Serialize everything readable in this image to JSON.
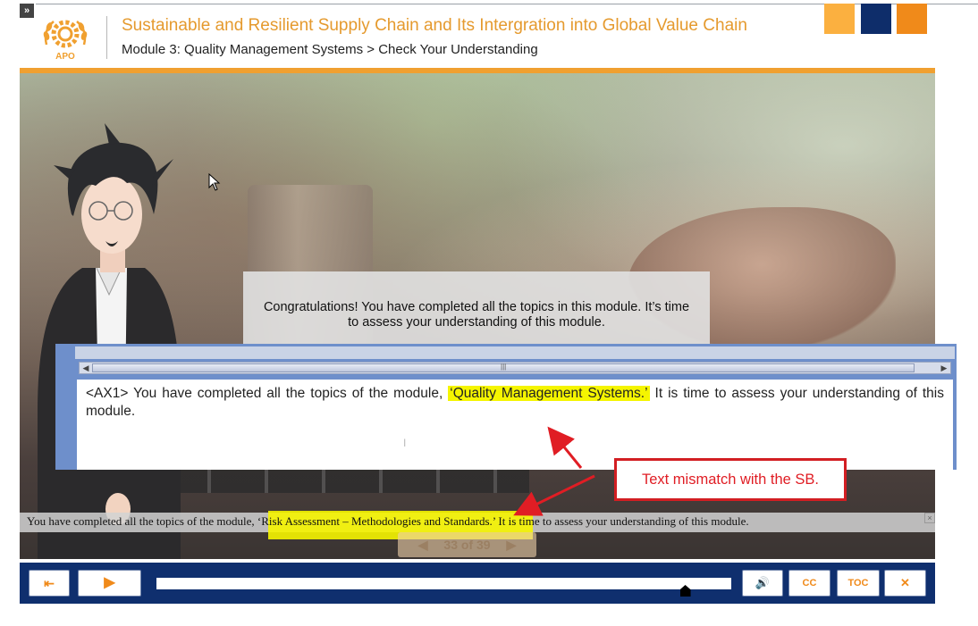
{
  "header": {
    "title": "Sustainable and Resilient Supply Chain and Its Intergration into Global Value Chain",
    "breadcrumb": "Module 3: Quality Management Systems > Check Your Understanding",
    "logo_text": "APO",
    "accent_squares": [
      "#fbb040",
      "#0e2d6a",
      "#f08a1a"
    ]
  },
  "stage": {
    "congrats_line1": "Congratulations! You have completed all the topics in this module. It’s time",
    "congrats_line2": "to assess your understanding of this module."
  },
  "notes": {
    "text_before": "<AX1> You have completed all the topics of the module, ",
    "text_highlight": "‘Quality Management Systems.’",
    "text_after": " It is time to assess your understanding of this module."
  },
  "callout": {
    "text": "Text mismatch with the SB."
  },
  "caption": {
    "text_before": "You have completed all the topics of the module, ",
    "text_highlight": "‘Risk Assessment – Methodologies and Standards.’",
    "text_after": " It is time to assess your understanding of this module.",
    "close_glyph": "×"
  },
  "pager": {
    "prev_glyph": "◀",
    "label": "33 of 39",
    "next_glyph": "▶"
  },
  "controls": {
    "exit_glyph": "⇤",
    "play_glyph": "▶",
    "volume_glyph": "🔊",
    "cc_label": "CC",
    "toc_label": "TOC",
    "close_glyph": "✕",
    "progress": 0.92
  },
  "colors": {
    "accent_orange": "#f0a030",
    "nav_blue": "#0f2f6e",
    "highlight_yellow": "#f5f500",
    "callout_red": "#d21e22"
  }
}
